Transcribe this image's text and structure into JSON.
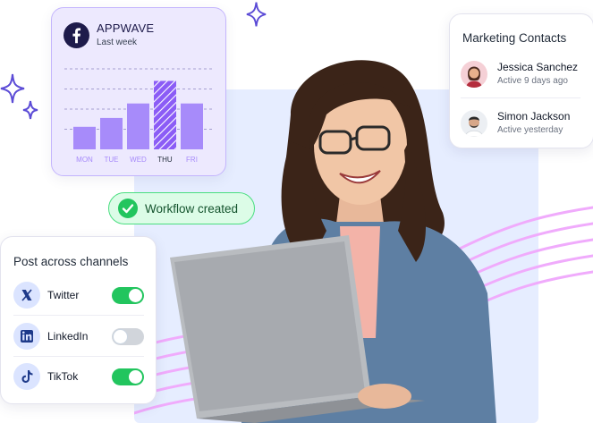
{
  "facebook_card": {
    "brand": "APPWAVE",
    "period": "Last week",
    "icon": "facebook-icon",
    "highlight_day": "THU"
  },
  "chart_data": {
    "type": "bar",
    "categories": [
      "MON",
      "TUE",
      "WED",
      "THU",
      "FRI"
    ],
    "values": [
      28,
      39,
      57,
      85,
      57
    ],
    "ylim": [
      0,
      100
    ],
    "highlighted_category": "THU",
    "grid": true,
    "colors": {
      "bar": "#a78bfa",
      "highlight": "#8b5cf6",
      "grid": "#a5a0d0"
    }
  },
  "workflow": {
    "label": "Workflow created",
    "icon": "check-circle-icon",
    "color": "#22c55e"
  },
  "contacts": {
    "title": "Marketing Contacts",
    "items": [
      {
        "name": "Jessica Sanchez",
        "status": "Active 9 days ago"
      },
      {
        "name": "Simon Jackson",
        "status": "Active yesterday"
      }
    ]
  },
  "channels": {
    "title": "Post across channels",
    "items": [
      {
        "name": "Twitter",
        "icon": "x-twitter-icon",
        "enabled": true
      },
      {
        "name": "LinkedIn",
        "icon": "linkedin-icon",
        "enabled": false
      },
      {
        "name": "TikTok",
        "icon": "tiktok-icon",
        "enabled": true
      }
    ]
  },
  "colors": {
    "accent_purple": "#6d28d9",
    "panel_blue": "#e6edff",
    "swirl_pink": "#f0abfc",
    "toggle_on": "#22c55e"
  }
}
